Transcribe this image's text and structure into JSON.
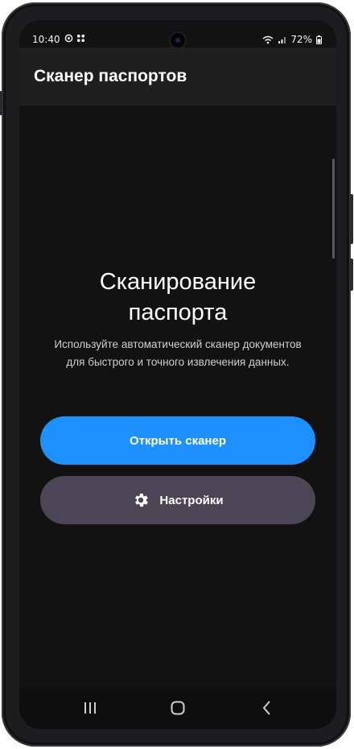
{
  "status_bar": {
    "time": "10:40",
    "battery": "72%",
    "left_icons": [
      "sync-icon",
      "apps-dots-icon"
    ],
    "right_icons": [
      "wifi-icon",
      "signal-icon",
      "battery-icon"
    ]
  },
  "app_bar": {
    "title": "Сканер паспортов"
  },
  "main": {
    "heading_line1": "Сканирование",
    "heading_line2": "паспорта",
    "description": "Используйте автоматический сканер документов для быстрого и точного извлечения данных.",
    "primary_button": "Открыть сканер",
    "secondary_button": "Настройки",
    "secondary_icon": "gear-icon"
  },
  "colors": {
    "background": "#121212",
    "app_bar": "#1f1f1f",
    "primary": "#1e90ff",
    "secondary": "#4b4556"
  },
  "nav_bar": {
    "items": [
      "recents-icon",
      "home-icon",
      "back-icon"
    ]
  }
}
